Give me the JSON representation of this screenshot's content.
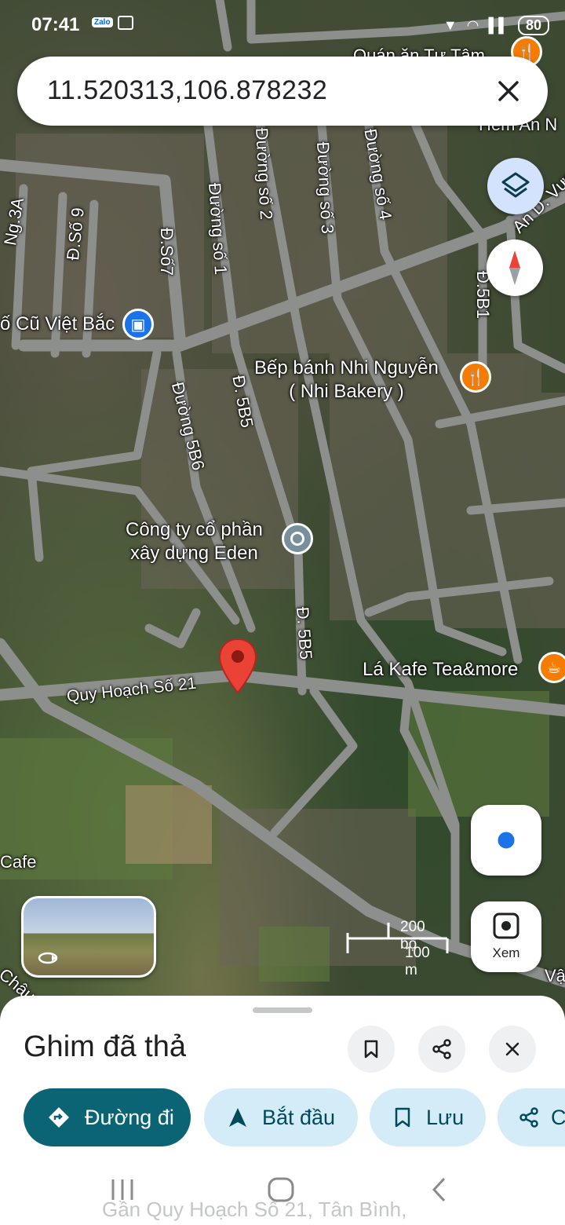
{
  "status_bar": {
    "time": "07:41",
    "notification_app": "Zalo",
    "battery": "80"
  },
  "search": {
    "query": "11.520313,106.878232"
  },
  "map": {
    "street_labels": [
      "Quán ăn Tự Tâm",
      "Hẻm An N",
      "Đường số 2",
      "Đường số 3",
      "Đường số 4",
      "Ng.3A",
      "Đ.Số 9",
      "Đ.Số7",
      "Đường số 1",
      "Đ.5B1",
      "Đường 5B6",
      "Đ. 5B5",
      "Đ. 5B5",
      "Quy Hoạch Số 21",
      "Cafe",
      "Châu",
      "Vậ",
      "An D. Vươ"
    ],
    "pois": {
      "market": "ố Cũ Việt Bắc",
      "bakery_line1": "Bếp bánh Nhi Nguyễn",
      "bakery_line2": "( Nhi Bakery )",
      "company_line1": "Công ty cổ phần",
      "company_line2": "xây dựng Eden",
      "cafe": "Lá Kafe Tea&more"
    },
    "scale": {
      "imperial": "200 bộ",
      "metric": "100 m"
    },
    "lens_label": "Xem"
  },
  "sheet": {
    "title": "Ghim đã thả",
    "chips": {
      "directions": "Đường đi",
      "start": "Bắt đầu",
      "save": "Lưu",
      "share": "C"
    },
    "address": "Gần Quy Hoạch Số 21, Tân Bình,"
  },
  "colors": {
    "primary_chip": "#0b6474",
    "secondary_chip": "#d3ecf7",
    "pin": "#ea4335",
    "poi_orange": "#f57c00",
    "poi_blue": "#1a73e8",
    "poi_gray": "#78909c"
  }
}
